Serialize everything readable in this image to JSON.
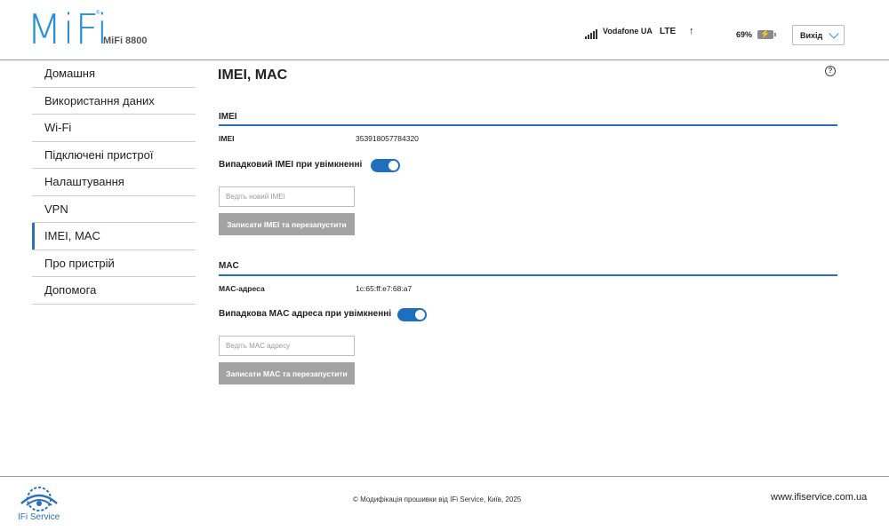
{
  "header": {
    "brand": "MiFi",
    "model": "MiFi 8800",
    "carrier": "Vodafone UA",
    "network": "LTE",
    "upload_arrow": "↑",
    "battery_percent": "69%",
    "battery_icon_glyph": "⚡",
    "logout_label": "Вихід"
  },
  "sidebar": {
    "items": [
      {
        "label": "Домашня"
      },
      {
        "label": "Використання даних"
      },
      {
        "label": "Wi-Fi"
      },
      {
        "label": "Підключені пристрої"
      },
      {
        "label": "Налаштування"
      },
      {
        "label": "VPN"
      },
      {
        "label": "IMEI, MAC"
      },
      {
        "label": "Про пристрій"
      },
      {
        "label": "Допомога"
      }
    ],
    "active": "IMEI, MAC"
  },
  "main": {
    "title": "IMEI, MAC",
    "help_glyph": "?",
    "imei": {
      "section_title": "IMEI",
      "label": "IMEI",
      "value": "353918057784320",
      "toggle_label": "Випадковий IMEI при увімкненні",
      "toggle_on": true,
      "input_placeholder": "Ведіть новий IMEI",
      "button_label": "Записати IMEI та перезапустити"
    },
    "mac": {
      "section_title": "MAC",
      "label": "MAC-адреса",
      "value": "1c:65:ff:e7:68:a7",
      "toggle_label": "Випадкова MAC адреса при увімкненні",
      "toggle_on": true,
      "input_placeholder": "Ведіть MAC адресу",
      "button_label": "Записати MAC та перезапустити"
    }
  },
  "footer": {
    "logo_text": "IFi Service",
    "copyright": "© Модифікація прошивки від IFi Service, Київ, 2025",
    "site": "www.ifiservice.com.ua"
  },
  "colors": {
    "accent": "#2b8fd6",
    "toggle_on": "#1f6fbd",
    "rule": "#2b6fb8",
    "button_disabled": "#a3a3a3"
  }
}
